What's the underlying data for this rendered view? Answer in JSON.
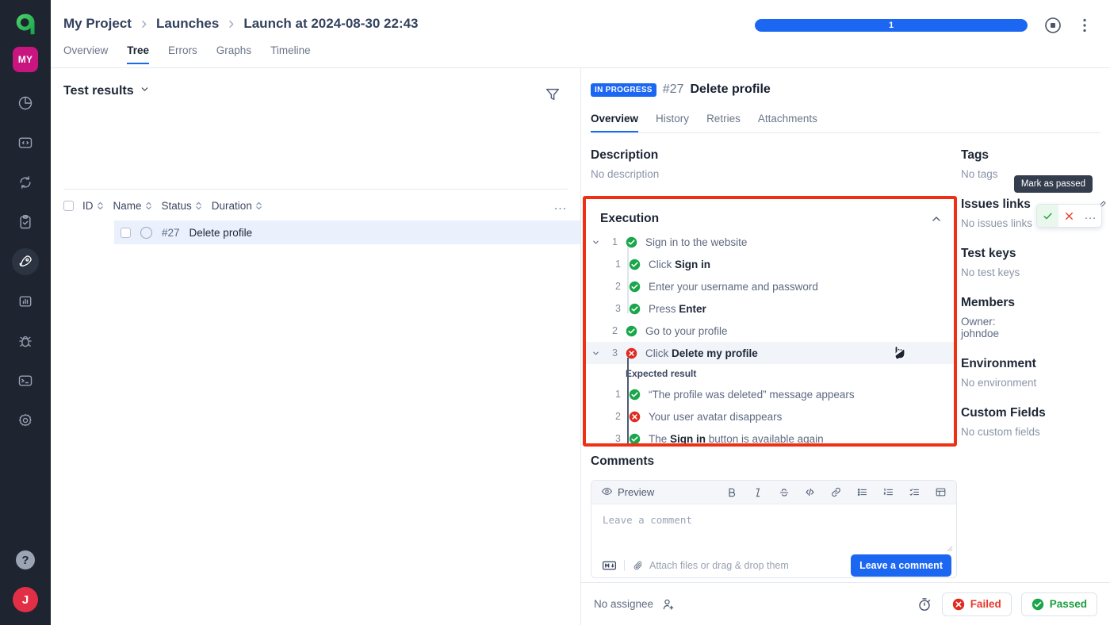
{
  "rail": {
    "logo_name": "allure-logo",
    "project_badge": "MY",
    "items": [
      {
        "name": "dashboards-icon",
        "label": "Dashboards",
        "active": false
      },
      {
        "name": "code-icon",
        "label": "Code",
        "active": false
      },
      {
        "name": "sync-icon",
        "label": "Sync",
        "active": false
      },
      {
        "name": "clipboard-check-icon",
        "label": "Test cases",
        "active": false
      },
      {
        "name": "rocket-icon",
        "label": "Launches",
        "active": true
      },
      {
        "name": "bar-chart-icon",
        "label": "Analytics",
        "active": false
      },
      {
        "name": "bug-icon",
        "label": "Defects",
        "active": false
      },
      {
        "name": "terminal-icon",
        "label": "Console",
        "active": false
      },
      {
        "name": "gear-icon",
        "label": "Settings",
        "active": false
      }
    ],
    "help_label": "?",
    "avatar_initial": "J"
  },
  "topbar": {
    "breadcrumb": [
      "My Project",
      "Launches",
      "Launch at 2024-08-30 22:43"
    ],
    "separator": "›",
    "progress": {
      "label": "1",
      "percent": 100,
      "color": "#1b67f2"
    },
    "stop_icon": "stop-icon",
    "menu_icon": "kebab-menu-icon"
  },
  "page_tabs": {
    "items": [
      "Overview",
      "Tree",
      "Errors",
      "Graphs",
      "Timeline"
    ],
    "selected": "Tree"
  },
  "left_pane": {
    "title": "Test results",
    "filter_icon": "filter-icon",
    "columns": [
      "ID",
      "Name",
      "Status",
      "Duration"
    ],
    "more_icon": "…",
    "rows": [
      {
        "id": "#27",
        "name": "Delete profile",
        "selected": true,
        "status_icon": "ring-icon"
      }
    ]
  },
  "detail": {
    "status_badge": "IN PROGRESS",
    "number": "#27",
    "title": "Delete profile",
    "tabs": [
      "Overview",
      "History",
      "Retries",
      "Attachments"
    ],
    "selected_tab": "Overview",
    "description": {
      "heading": "Description",
      "value": "No description"
    },
    "execution": {
      "heading": "Execution",
      "collapse_icon": "chevron-up-icon",
      "highlighted": true,
      "highlight_color": "#f03014",
      "steps": [
        {
          "index": "1",
          "status": "passed",
          "text": "Sign in to the website",
          "bold": "",
          "expandable": true,
          "children": [
            {
              "index": "1",
              "status": "passed",
              "text": "Click ",
              "bold": "Sign in",
              "tail": ""
            },
            {
              "index": "2",
              "status": "passed",
              "text": "Enter your username and password",
              "bold": "",
              "tail": ""
            },
            {
              "index": "3",
              "status": "passed",
              "text": "Press ",
              "bold": "Enter",
              "tail": ""
            }
          ]
        },
        {
          "index": "2",
          "status": "passed",
          "text": "Go to your profile",
          "bold": "",
          "expandable": false,
          "children": []
        },
        {
          "index": "3",
          "status": "failed",
          "text": "Click ",
          "bold": "Delete my profile",
          "tail": "",
          "expandable": true,
          "active": true,
          "expected_label": "Expected result",
          "children": [
            {
              "index": "1",
              "status": "passed",
              "text": "“The profile was deleted” message appears",
              "bold": "",
              "tail": ""
            },
            {
              "index": "2",
              "status": "failed",
              "text": "Your user avatar disappears",
              "bold": "",
              "tail": ""
            },
            {
              "index": "3",
              "status": "passed",
              "text": "The ",
              "bold": "Sign in",
              "tail": " button is available again"
            }
          ]
        }
      ],
      "hover_actions": {
        "tooltip": "Mark as passed",
        "pass_icon": "check-icon",
        "fail_icon": "cross-icon",
        "more_icon": "…"
      }
    },
    "comments": {
      "heading": "Comments",
      "preview_label": "Preview",
      "preview_icon": "eye-icon",
      "tools": [
        "bold-icon",
        "italic-icon",
        "strikethrough-icon",
        "code-icon",
        "link-icon",
        "bullet-list-icon",
        "numbered-list-icon",
        "checklist-icon",
        "table-icon"
      ],
      "placeholder": "Leave a comment",
      "markdown_icon": "markdown-icon",
      "attach_icon": "paperclip-icon",
      "attach_label": "Attach files or drag & drop them",
      "submit_label": "Leave a comment"
    },
    "meta": [
      {
        "heading": "Tags",
        "value": "No tags",
        "edit": false
      },
      {
        "heading": "Issues links",
        "value": "No issues links",
        "edit": true,
        "edit_icon": "pencil-icon"
      },
      {
        "heading": "Test keys",
        "value": "No test keys",
        "edit": false
      },
      {
        "heading": "Members",
        "value": "Owner:\njohndoe",
        "edit": false,
        "dark": true
      },
      {
        "heading": "Environment",
        "value": "No environment",
        "edit": false
      },
      {
        "heading": "Custom Fields",
        "value": "No custom fields",
        "edit": false
      }
    ],
    "bottom": {
      "assignee_label": "No assignee",
      "add_person_icon": "add-person-icon",
      "timer_icon": "stopwatch-icon",
      "fail_label": "Failed",
      "pass_label": "Passed",
      "fail_color": "#e8392c",
      "pass_color": "#1a9e3d"
    }
  }
}
